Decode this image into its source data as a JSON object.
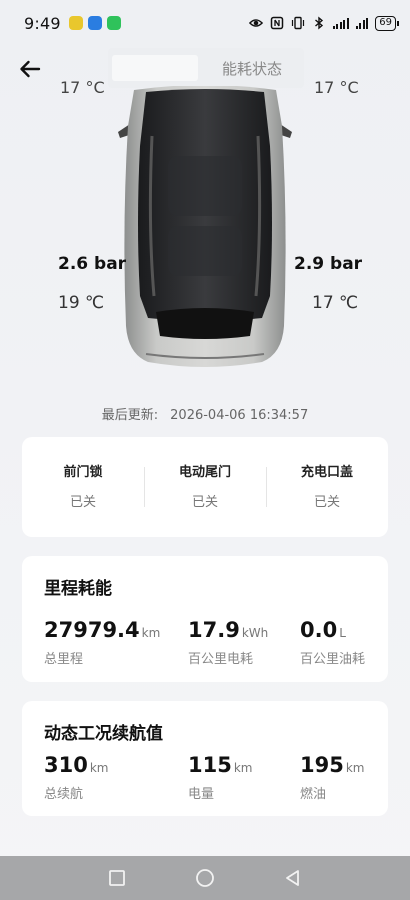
{
  "status_bar": {
    "time": "9:49",
    "battery": "69",
    "app_icon_colors": [
      "#e9c72d",
      "#2a7de1",
      "#2fc25b"
    ]
  },
  "header": {
    "back_icon": "arrow-left-icon",
    "title": "能耗状态"
  },
  "car": {
    "front_left_temp_partial": "17 °C",
    "front_right_temp_partial": "17 °C",
    "rear_left_pressure": "2.6 bar",
    "rear_left_temp": "19 ℃",
    "rear_right_pressure": "2.9 bar",
    "rear_right_temp": "17 ℃"
  },
  "last_update": {
    "label": "最后更新:",
    "time": "2026-04-06 16:34:57"
  },
  "door_status": [
    {
      "label": "前门锁",
      "value": "已关"
    },
    {
      "label": "电动尾门",
      "value": "已关"
    },
    {
      "label": "充电口盖",
      "value": "已关"
    }
  ],
  "mileage_card": {
    "title": "里程耗能",
    "stats": [
      {
        "value": "27979.4",
        "unit": "km",
        "desc": "总里程"
      },
      {
        "value": "17.9",
        "unit": "kWh",
        "desc": "百公里电耗"
      },
      {
        "value": "0.0",
        "unit": "L",
        "desc": "百公里油耗"
      }
    ]
  },
  "range_card": {
    "title": "动态工况续航值",
    "stats": [
      {
        "value": "310",
        "unit": "km",
        "desc": "总续航"
      },
      {
        "value": "115",
        "unit": "km",
        "desc": "电量"
      },
      {
        "value": "195",
        "unit": "km",
        "desc": "燃油"
      }
    ]
  },
  "nav_bar": {
    "icons": [
      "square-icon",
      "circle-icon",
      "triangle-back-icon"
    ]
  }
}
